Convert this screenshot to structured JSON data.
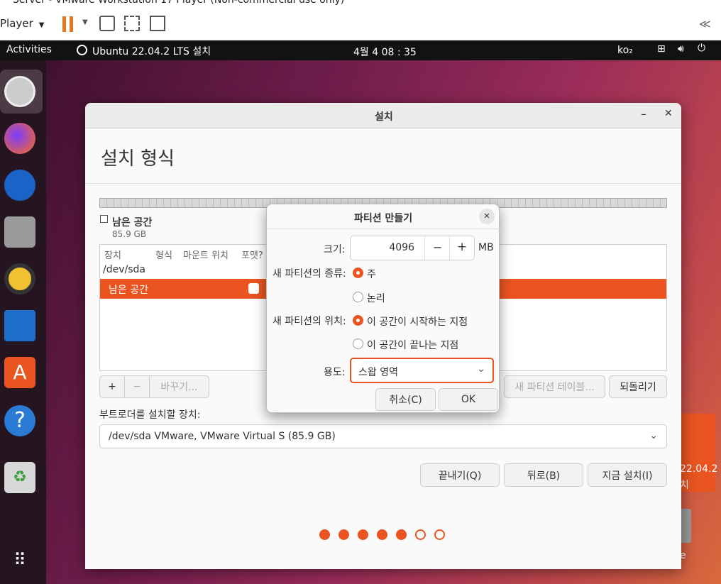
{
  "vmware": {
    "title": "Server - VMware Workstation 17 Player (Non-commercial use only)",
    "player_menu": "Player"
  },
  "topbar": {
    "activities": "Activities",
    "app_name": "Ubuntu 22.04.2 LTS 설치",
    "clock": "4월 4  08 : 35",
    "input_method": "ko₂"
  },
  "window": {
    "title": "설치",
    "heading": "설치 형식",
    "free_space_label": "남은 공간",
    "free_space_size": "85.9 GB",
    "table_headers": [
      "장치",
      "형식",
      "마운트 위치",
      "포맷?"
    ],
    "rows": [
      {
        "device": "/dev/sda"
      },
      {
        "device": "남은 공간",
        "selected": true
      }
    ],
    "add_label": "+",
    "remove_label": "−",
    "change_label": "바꾸기...",
    "new_table_label": "새 파티션 테이블...",
    "revert_label": "되돌리기",
    "bootloader_label": "부트로더를 설치할 장치:",
    "bootloader_value": "/dev/sda VMware, VMware Virtual S (85.9 GB)",
    "quit_label": "끝내기(Q)",
    "back_label": "뒤로(B)",
    "install_label": "지금 설치(I)",
    "progress_filled": 5,
    "progress_total": 7
  },
  "modal": {
    "title": "파티션 만들기",
    "size_label": "크기:",
    "size_value": "4096",
    "size_unit": "MB",
    "minus": "−",
    "plus": "+",
    "type_label": "새 파티션의 종류:",
    "type_primary": "주",
    "type_logical": "논리",
    "location_label": "새 파티션의 위치:",
    "location_start": "이 공간이 시작하는 지점",
    "location_end": "이 공간이 끝나는 지점",
    "use_label": "용도:",
    "use_value": "스왑 영역",
    "cancel_label": "취소(C)",
    "ok_label": "OK"
  },
  "background_window": {
    "version_fragment": "22.04.2",
    "text_fragment": "치",
    "e_fragment": "e"
  },
  "colors": {
    "accent": "#e95420",
    "topbar": "#121212",
    "dock": "#241520"
  }
}
